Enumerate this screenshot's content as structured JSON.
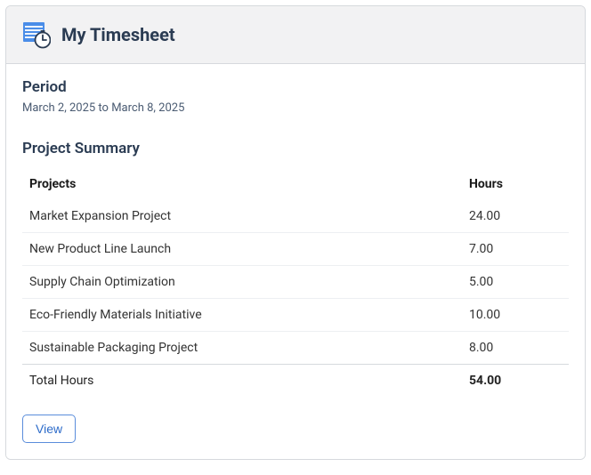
{
  "header": {
    "title": "My Timesheet"
  },
  "period": {
    "heading": "Period",
    "text": "March 2, 2025 to March 8, 2025"
  },
  "summary": {
    "heading": "Project Summary",
    "columns": {
      "projects": "Projects",
      "hours": "Hours"
    },
    "rows": [
      {
        "project": "Market Expansion Project",
        "hours": "24.00"
      },
      {
        "project": "New Product Line Launch",
        "hours": "7.00"
      },
      {
        "project": "Supply Chain Optimization",
        "hours": "5.00"
      },
      {
        "project": "Eco-Friendly Materials Initiative",
        "hours": "10.00"
      },
      {
        "project": "Sustainable Packaging Project",
        "hours": "8.00"
      }
    ],
    "total": {
      "label": "Total Hours",
      "value": "54.00"
    }
  },
  "actions": {
    "view_label": "View"
  }
}
